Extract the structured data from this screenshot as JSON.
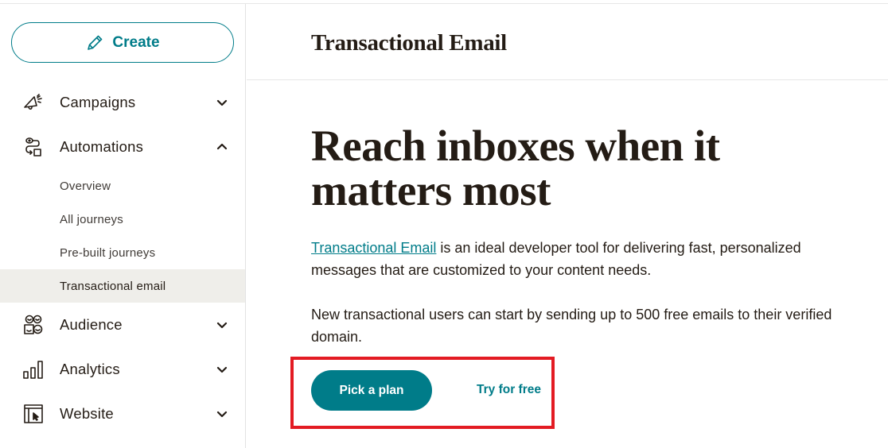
{
  "sidebar": {
    "create_label": "Create",
    "items": [
      {
        "label": "Campaigns",
        "icon": "megaphone-icon",
        "expanded": false
      },
      {
        "label": "Automations",
        "icon": "automation-flow-icon",
        "expanded": true
      },
      {
        "label": "Audience",
        "icon": "audience-icon",
        "expanded": false
      },
      {
        "label": "Analytics",
        "icon": "bar-chart-icon",
        "expanded": false
      },
      {
        "label": "Website",
        "icon": "website-icon",
        "expanded": false
      }
    ],
    "automations_sub": [
      {
        "label": "Overview"
      },
      {
        "label": "All journeys"
      },
      {
        "label": "Pre-built journeys"
      },
      {
        "label": "Transactional email",
        "active": true
      }
    ]
  },
  "header": {
    "title": "Transactional Email"
  },
  "hero": {
    "title": "Reach inboxes when it matters most",
    "para1_link": "Transactional Email",
    "para1_rest": " is an ideal developer tool for delivering fast, personalized messages that are customized to your content needs.",
    "para2": "New transactional users can start by sending up to 500 free emails to their verified domain.",
    "primary_button": "Pick a plan",
    "secondary_link": "Try for free"
  },
  "colors": {
    "accent": "#007c89",
    "highlight": "#e31b23",
    "active_bg": "#efeeea",
    "text": "#241c15"
  }
}
